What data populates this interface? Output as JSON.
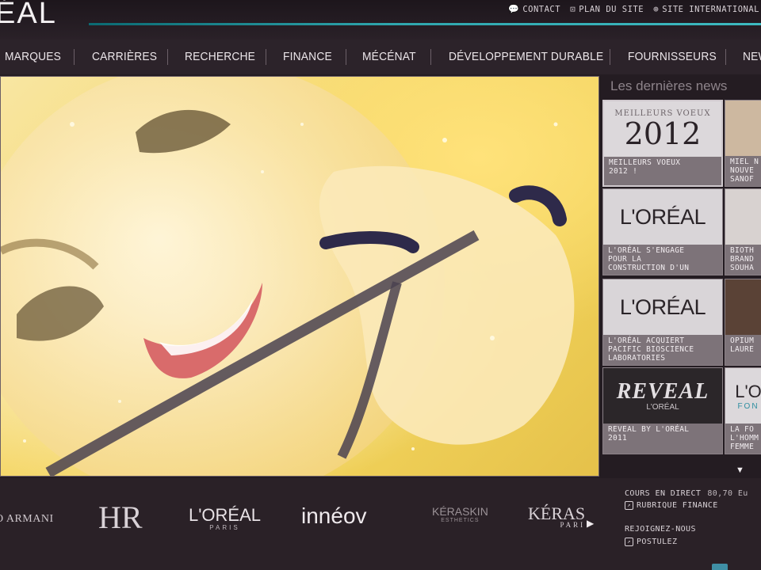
{
  "header": {
    "logo": "ÉAL",
    "util_links": [
      {
        "icon": "speech-bubble-icon",
        "glyph": "💬",
        "label": "CONTACT"
      },
      {
        "icon": "sitemap-icon",
        "glyph": "⊡",
        "label": "PLAN DU SITE"
      },
      {
        "icon": "globe-icon",
        "glyph": "⊕",
        "label": "SITE INTERNATIONAL"
      }
    ],
    "accent_color": "#2fa6ad"
  },
  "nav": {
    "items": [
      "MARQUES",
      "CARRIÈRES",
      "RECHERCHE",
      "FINANCE",
      "MÉCÉNAT",
      "DÉVELOPPEMENT DURABLE",
      "FOURNISSEURS",
      "NEW"
    ]
  },
  "news": {
    "title": "Les dernières news",
    "cards": [
      {
        "thumb_small": "MEILLEURS VOEUX",
        "thumb_big": "2012",
        "caption": "MEILLEURS VOEUX\n2012 !"
      },
      {
        "caption": "MIEL N\nNOUVE\nSANOF"
      },
      {
        "thumb_text": "L'ORÉAL",
        "caption": "L'ORÉAL S'ENGAGE\nPOUR LA\nCONSTRUCTION D'UN"
      },
      {
        "caption": "BIOTH\nBRAND\nSOUHA"
      },
      {
        "thumb_text": "L'ORÉAL",
        "caption": "L'ORÉAL ACQUIERT\nPACIFIC BIOSCIENCE\nLABORATORIES"
      },
      {
        "caption": "OPIUM\nLAURE"
      },
      {
        "thumb_big": "REVEAL",
        "thumb_small": "L'ORÉAL",
        "caption": "REVEAL BY L'ORÉAL\n2011"
      },
      {
        "thumb_text": "L'O",
        "thumb_sub": "FON",
        "caption": "LA FO\nL'HOMM\nFEMME"
      }
    ],
    "scroll_glyph": "▼"
  },
  "brands": [
    {
      "name": "O ARMANI"
    },
    {
      "name": "HR"
    },
    {
      "name": "L'ORÉAL",
      "sub": "PARIS"
    },
    {
      "name": "innéov"
    },
    {
      "name": "KÉRASKIN",
      "sub": "ESTHETICS"
    },
    {
      "name": "KÉRAS",
      "sub": "PARI"
    }
  ],
  "brand_next_glyph": "▶",
  "footer": {
    "stock_label": "COURS EN DIRECT",
    "stock_price": "80,70 Eu",
    "finance_link": "RUBRIQUE FINANCE",
    "join_label": "REJOIGNEZ-NOUS",
    "apply_link": "POSTULEZ"
  }
}
